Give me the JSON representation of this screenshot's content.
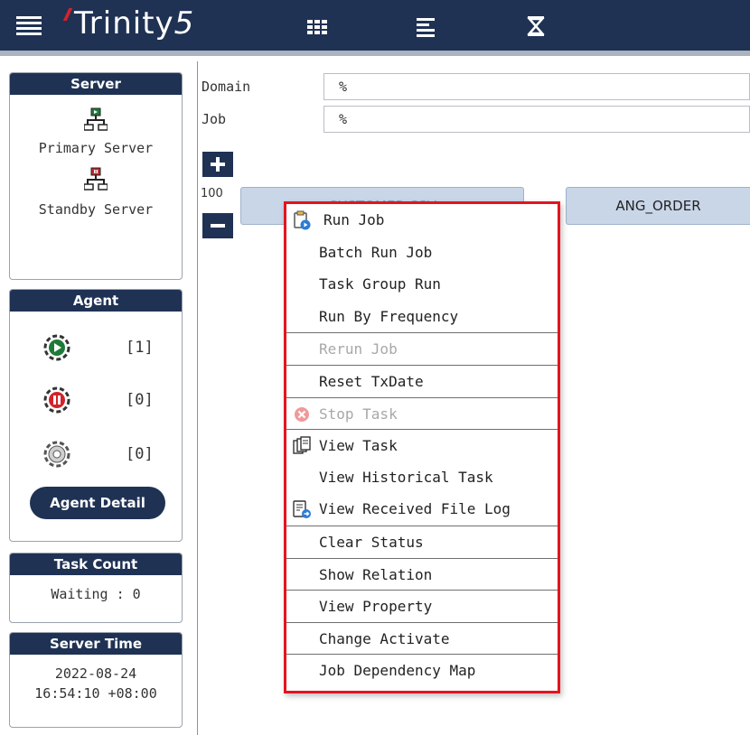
{
  "topbar": {
    "brand_main": "Trinity",
    "brand_num": "5",
    "accent_color": "#d2232a",
    "bar_color": "#1f3254",
    "icons": [
      "menu-icon",
      "grid-icon",
      "list-icon",
      "hourglass-icon"
    ]
  },
  "server": {
    "title": "Server",
    "primary_label": "Primary Server",
    "standby_label": "Standby Server"
  },
  "agent": {
    "title": "Agent",
    "running_count": "[1]",
    "stopped_count": "[0]",
    "idle_count": "[0]",
    "detail_button": "Agent Detail"
  },
  "task_count": {
    "title": "Task Count",
    "waiting": "Waiting : 0"
  },
  "server_time": {
    "title": "Server Time",
    "date": "2022-08-24",
    "time": "16:54:10 +08:00"
  },
  "filters": {
    "domain_label": "Domain",
    "domain_value": "%",
    "job_label": "Job",
    "job_value": "%"
  },
  "canvas": {
    "zoom": "100",
    "node1": "CUSTOMER CSV",
    "node2": "ANG_ORDER"
  },
  "context_menu": {
    "border_color": "#e3141e",
    "items": [
      {
        "label": "Run Job"
      },
      {
        "label": "Batch Run Job"
      },
      {
        "label": "Task Group Run"
      },
      {
        "label": "Run By Frequency"
      },
      {
        "label": "Rerun Job"
      },
      {
        "label": "Reset TxDate"
      },
      {
        "label": "Stop Task"
      },
      {
        "label": "View Task"
      },
      {
        "label": "View Historical Task"
      },
      {
        "label": "View Received File Log"
      },
      {
        "label": "Clear Status"
      },
      {
        "label": "Show Relation"
      },
      {
        "label": "View Property"
      },
      {
        "label": "Change Activate"
      },
      {
        "label": "Job Dependency Map"
      }
    ]
  }
}
